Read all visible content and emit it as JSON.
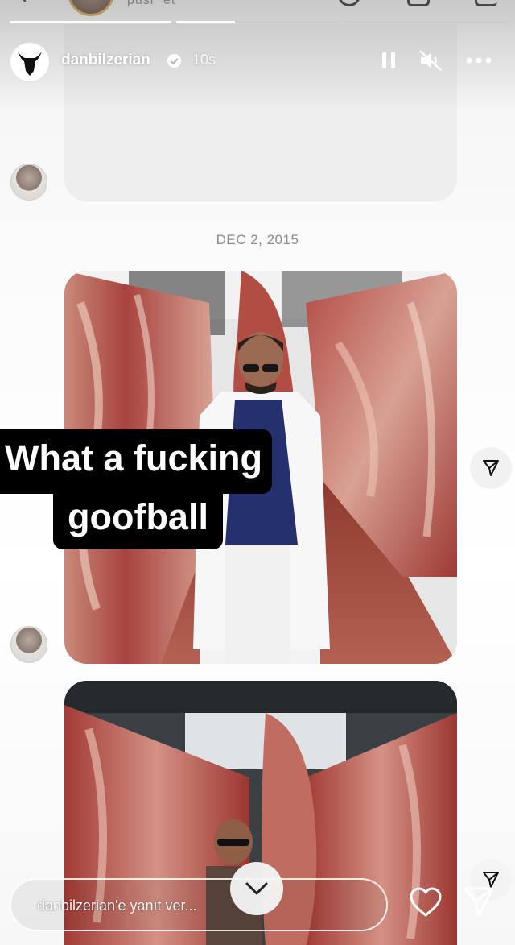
{
  "dm_header": {
    "username_partial": "pusr_et"
  },
  "story": {
    "username": "danbilzerian",
    "time_ago": "10s",
    "progress": [
      1.0,
      0.36,
      0.0
    ]
  },
  "thread": {
    "date_separator": "DEC 2, 2015"
  },
  "caption": {
    "line1": "What a fucking",
    "line2": "goofball"
  },
  "reply": {
    "placeholder": "danbilzerian'e yanıt ver..."
  },
  "icons": {
    "back": "chevron-left-icon",
    "pause": "pause-icon",
    "mute": "speaker-muted-icon",
    "more": "more-horizontal-icon",
    "verified": "verified-badge-icon",
    "share": "share-arrow-icon",
    "heart": "heart-icon",
    "send": "send-icon",
    "scroll": "chevron-down-icon"
  },
  "colors": {
    "caption_bg": "#000000",
    "caption_text": "#ffffff",
    "bubble": "#eeeeef",
    "verified": "#ffffff"
  }
}
